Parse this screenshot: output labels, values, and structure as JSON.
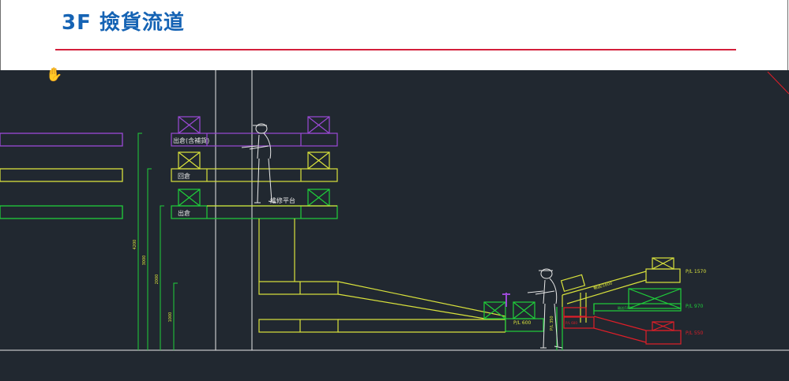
{
  "slide": {
    "title": "3F  撿貨流道"
  },
  "drawing": {
    "level_labels": {
      "outbound_top": "出倉(含補貨)",
      "return": "回倉",
      "outbound_bottom": "出倉",
      "maintenance": "維修平台"
    },
    "dimensions": {
      "d4200": "4200",
      "d3000": "3000",
      "d2000": "2000",
      "d1000": "1000"
    },
    "conveyor_labels": {
      "pl_1570": "P/L 1570",
      "pl_970": "P/L 970",
      "pl_600": "P/L 600",
      "pl_550": "P/L 550",
      "slope_upper": "輸送/1800",
      "slope_lower": "輸送/1800",
      "red_label": "P/L 600",
      "vertical_label": "P/L 350"
    },
    "colors": {
      "background": "#212830",
      "green": "#1fcf3a",
      "yellow": "#d9e23c",
      "purple": "#9b49d6",
      "red": "#e01e28",
      "white": "#e7e7e7"
    }
  }
}
